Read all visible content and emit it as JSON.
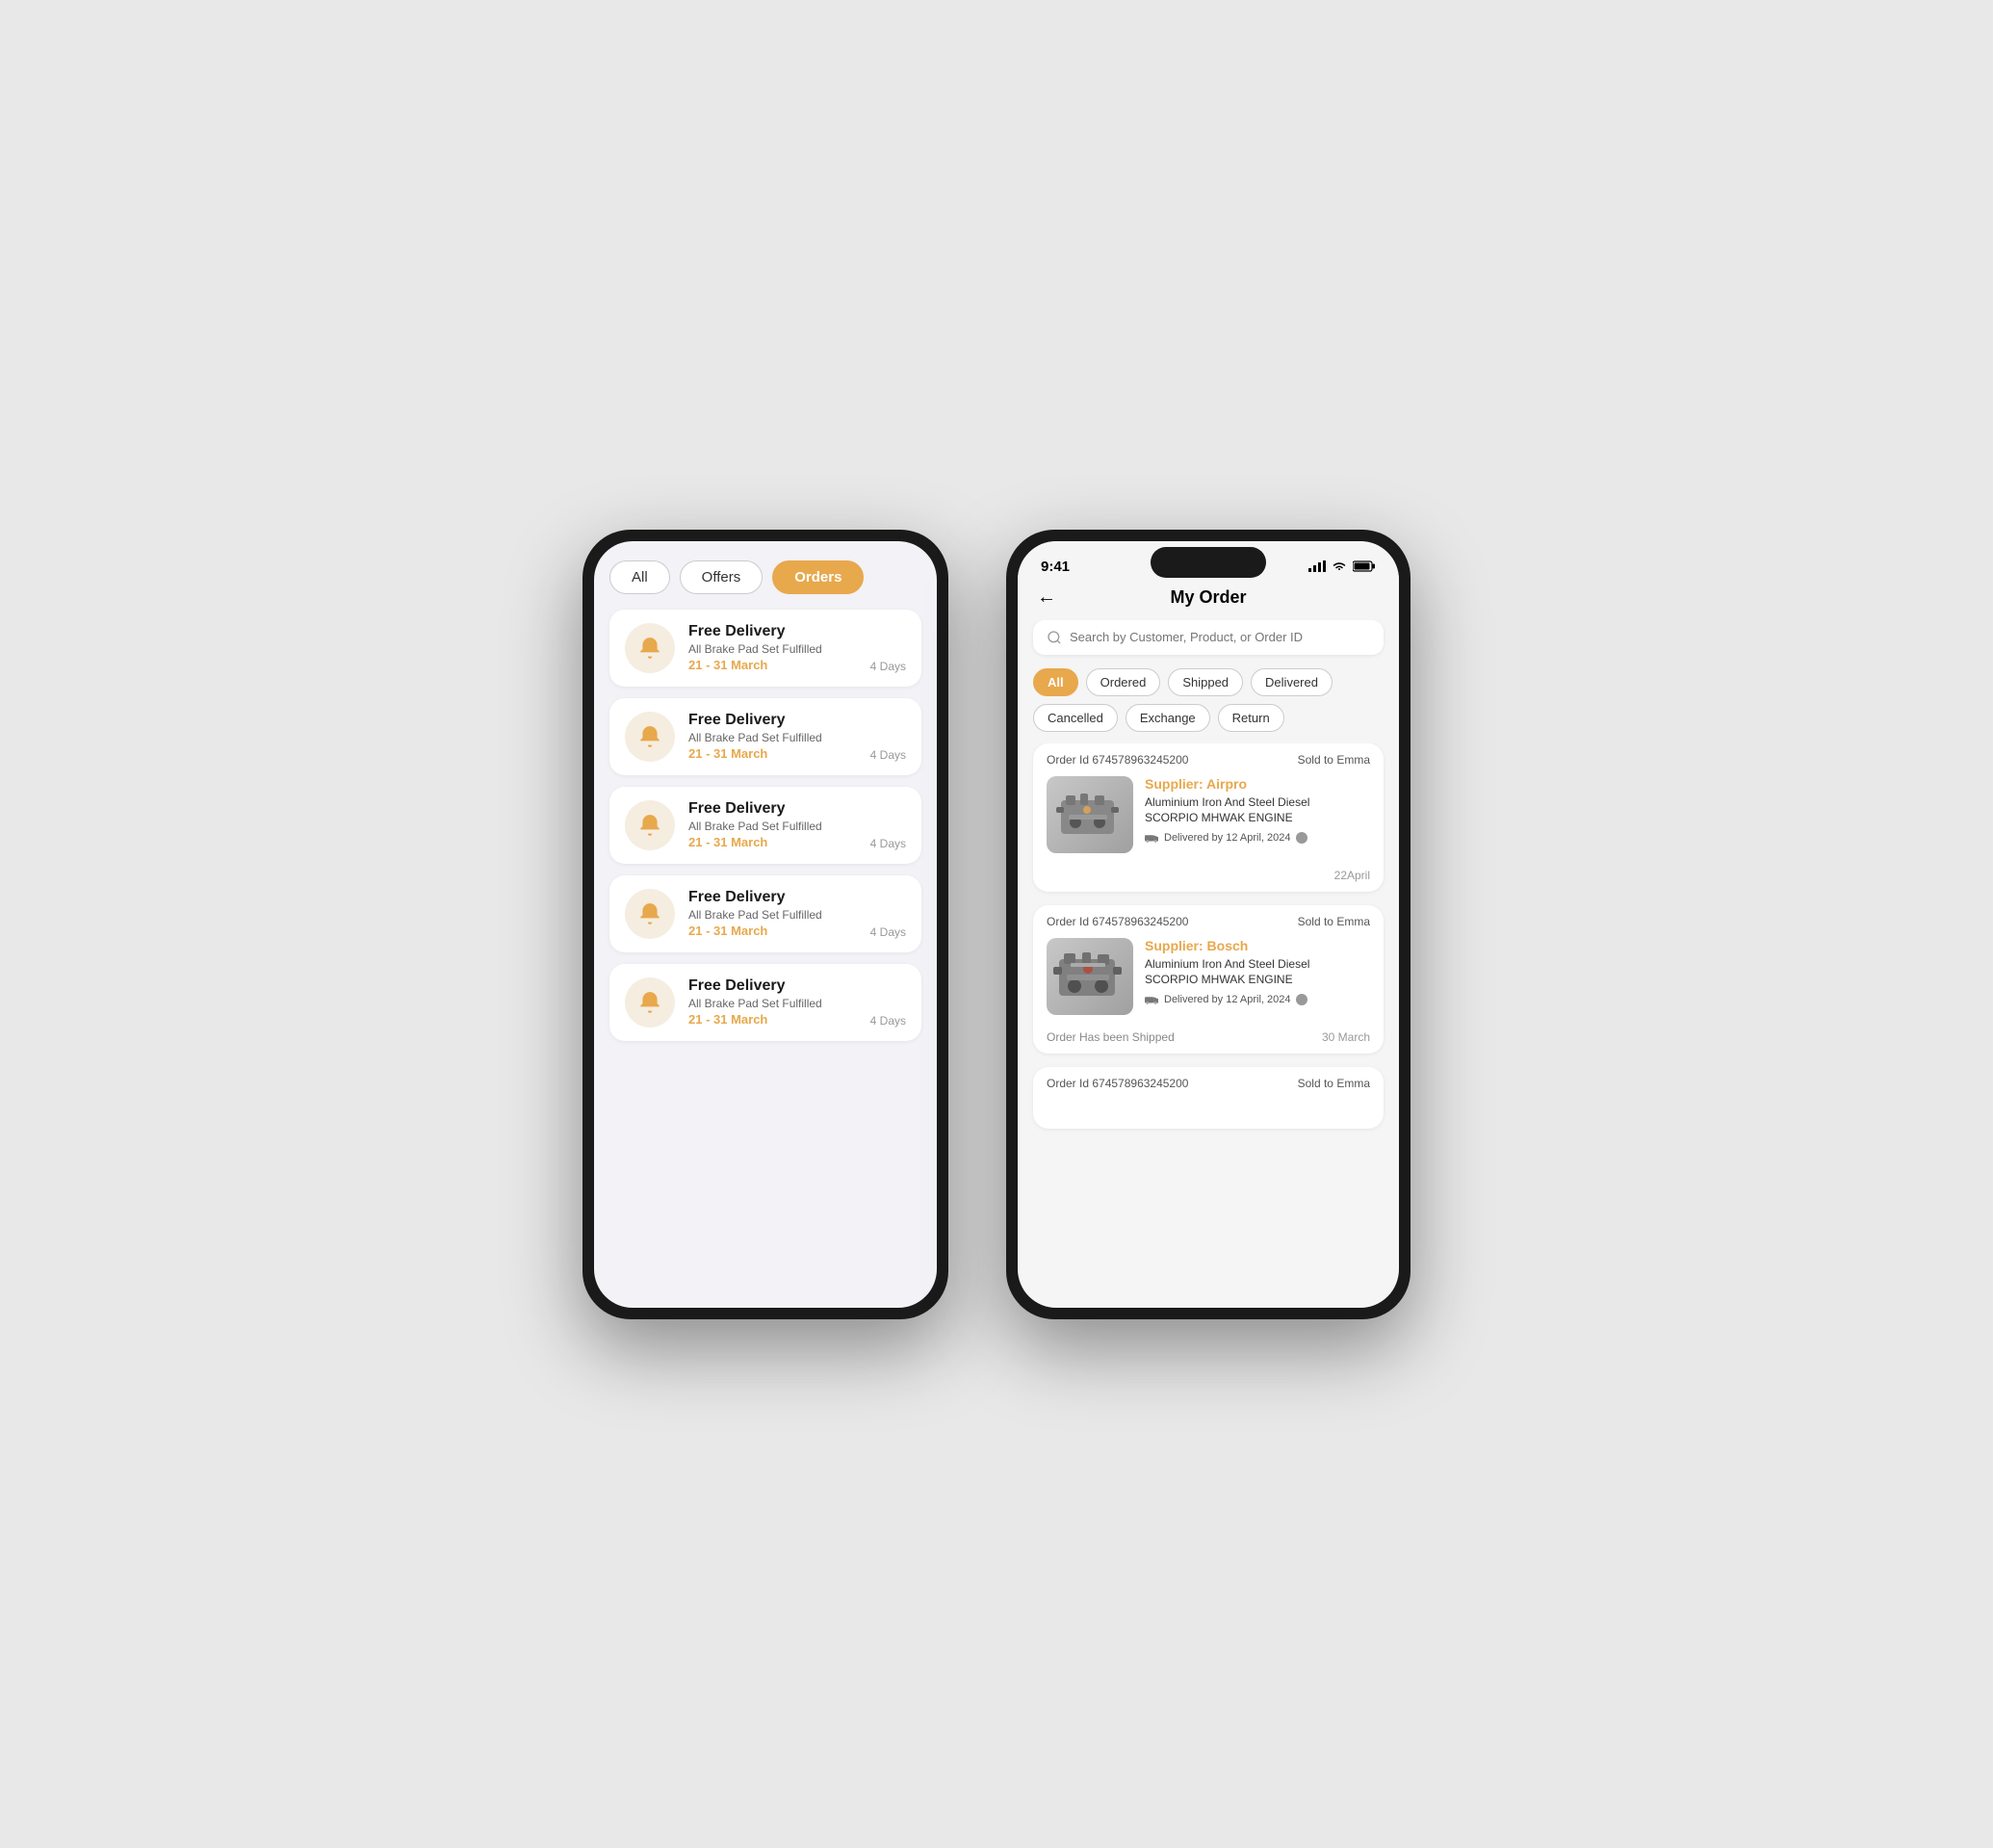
{
  "phone1": {
    "tabs": [
      {
        "label": "All",
        "active": false
      },
      {
        "label": "Offers",
        "active": false
      },
      {
        "label": "Orders",
        "active": true
      }
    ],
    "notifications": [
      {
        "title": "Free Delivery",
        "subtitle": "All Brake Pad Set Fulfilled",
        "date": "21 - 31 March",
        "days": "4 Days"
      },
      {
        "title": "Free Delivery",
        "subtitle": "All Brake Pad Set Fulfilled",
        "date": "21 - 31 March",
        "days": "4 Days"
      },
      {
        "title": "Free Delivery",
        "subtitle": "All Brake Pad Set Fulfilled",
        "date": "21 - 31 March",
        "days": "4 Days"
      },
      {
        "title": "Free Delivery",
        "subtitle": "All Brake Pad Set Fulfilled",
        "date": "21 - 31 March",
        "days": "4 Days"
      },
      {
        "title": "Free Delivery",
        "subtitle": "All Brake Pad Set Fulfilled",
        "date": "21 - 31 March",
        "days": "4 Days"
      }
    ]
  },
  "phone2": {
    "statusBar": {
      "time": "9:41"
    },
    "header": {
      "backLabel": "←",
      "title": "My Order"
    },
    "search": {
      "placeholder": "Search by Customer, Product, or Order ID"
    },
    "filters": [
      {
        "label": "All",
        "active": true
      },
      {
        "label": "Ordered",
        "active": false
      },
      {
        "label": "Shipped",
        "active": false
      },
      {
        "label": "Delivered",
        "active": false
      },
      {
        "label": "Cancelled",
        "active": false
      },
      {
        "label": "Exchange",
        "active": false
      },
      {
        "label": "Return",
        "active": false
      }
    ],
    "orders": [
      {
        "orderId": "Order Id 674578963245200",
        "soldTo": "Sold to Emma",
        "supplierName": "Supplier: Airpro",
        "productLine1": "Aluminium Iron And Steel Diesel",
        "productLine2": "SCORPIO MHWAK ENGINE",
        "delivery": "Delivered by 12 April, 2024",
        "shippedStatus": "",
        "dateLabel": "22April"
      },
      {
        "orderId": "Order Id 674578963245200",
        "soldTo": "Sold to Emma",
        "supplierName": "Supplier: Bosch",
        "productLine1": "Aluminium Iron And Steel Diesel",
        "productLine2": "SCORPIO MHWAK ENGINE",
        "delivery": "Delivered by 12 April, 2024",
        "shippedStatus": "Order Has been Shipped",
        "dateLabel": "30 March"
      },
      {
        "orderId": "Order Id 674578963245200",
        "soldTo": "Sold to Emma",
        "supplierName": "",
        "productLine1": "",
        "productLine2": "",
        "delivery": "",
        "shippedStatus": "",
        "dateLabel": ""
      }
    ]
  }
}
